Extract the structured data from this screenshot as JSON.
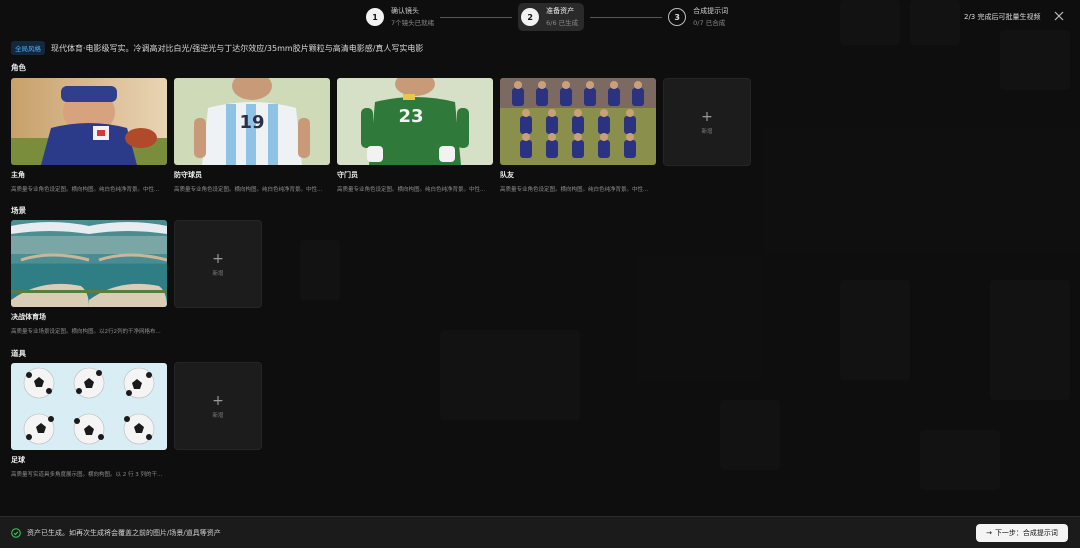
{
  "stepper": {
    "steps": [
      {
        "num": "1",
        "title": "确认镜头",
        "sub": "7个镜头已就绪"
      },
      {
        "num": "2",
        "title": "准备资产",
        "sub": "6/6 已生成"
      },
      {
        "num": "3",
        "title": "合成提示词",
        "sub": "0/7 已合成"
      }
    ]
  },
  "top_status": "2/3 完成后可批量生视频",
  "style": {
    "tag": "全局风格",
    "text": "现代体育·电影级写实。冷调高对比白光/强逆光与丁达尔效应/35mm胶片颗粒与高清电影感/真人写实电影"
  },
  "sections": {
    "characters": {
      "title": "角色",
      "cards": [
        {
          "name": "主角",
          "desc": "高质量专业角色设定图。横向构图。纯白色纯净背景。中性..."
        },
        {
          "name": "防守球员",
          "desc": "高质量专业角色设定图。横向构图。纯白色纯净背景。中性..."
        },
        {
          "name": "守门员",
          "desc": "高质量专业角色设定图。横向构图。纯白色纯净背景。中性..."
        },
        {
          "name": "队友",
          "desc": "高质量专业角色设定图。横向构图。纯白色纯净背景。中性..."
        }
      ],
      "add_label": "新增"
    },
    "scenes": {
      "title": "场景",
      "cards": [
        {
          "name": "决战体育场",
          "desc": "高质量专业场景设定图。横向构图。以2行2列的干净网格布..."
        }
      ],
      "add_label": "新增"
    },
    "props": {
      "title": "道具",
      "cards": [
        {
          "name": "足球",
          "desc": "高质量写实道具多角度展示图。横向构图。以 2 行 3 列的干..."
        }
      ],
      "add_label": "新增"
    }
  },
  "bottom": {
    "message": "资产已生成。如再次生成将会覆盖之前的图片/场景/道具等资产",
    "next_label": "下一步：合成提示词"
  },
  "colors": {
    "background": "#141414",
    "accent_tag": "#4fb0ff",
    "check_green": "#3ecf5f"
  }
}
